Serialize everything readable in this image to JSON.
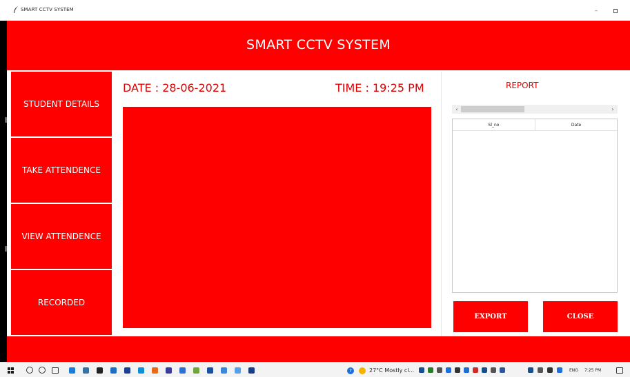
{
  "window": {
    "title": "SMART CCTV SYSTEM",
    "minimize_glyph": "–",
    "title_icon": "feather-icon"
  },
  "header": {
    "title": "SMART CCTV SYSTEM"
  },
  "nav": {
    "student_details": "STUDENT DETAILS",
    "take_attendence": "TAKE ATTENDENCE",
    "view_attendence": "VIEW ATTENDENCE",
    "recorded": "RECORDED"
  },
  "main": {
    "date": "DATE :  28-06-2021",
    "time": "TIME : 19:25 PM"
  },
  "report": {
    "title": "REPORT",
    "columns": [
      "Sl_no",
      "Date"
    ],
    "rows": [],
    "export_label": "EXPORT",
    "close_label": "CLOSE"
  },
  "taskbar": {
    "icons": [
      {
        "name": "edge-icon",
        "color": "#1e7ad6"
      },
      {
        "name": "python-icon",
        "color": "#3572a5"
      },
      {
        "name": "store-icon",
        "color": "#222222"
      },
      {
        "name": "vscode-icon",
        "color": "#1b6fc2"
      },
      {
        "name": "app-icon-1",
        "color": "#1c3f94"
      },
      {
        "name": "app-icon-2",
        "color": "#0f8fd6"
      },
      {
        "name": "app-icon-3",
        "color": "#e86a1a"
      },
      {
        "name": "app-icon-4",
        "color": "#3b3b9e"
      },
      {
        "name": "app-icon-5",
        "color": "#2d6fd1"
      },
      {
        "name": "app-icon-6",
        "color": "#6fa63a"
      },
      {
        "name": "app-icon-7",
        "color": "#1b4fa0"
      },
      {
        "name": "app-icon-8",
        "color": "#3a86d9"
      },
      {
        "name": "app-icon-9",
        "color": "#5aa0e6"
      },
      {
        "name": "app-icon-10",
        "color": "#1a3d8a"
      }
    ],
    "weather": "27°C  Mostly cl...",
    "lang": "ENG",
    "time": "7:25 PM"
  },
  "colors": {
    "accent": "#ff0000",
    "text_accent": "#e00000"
  }
}
